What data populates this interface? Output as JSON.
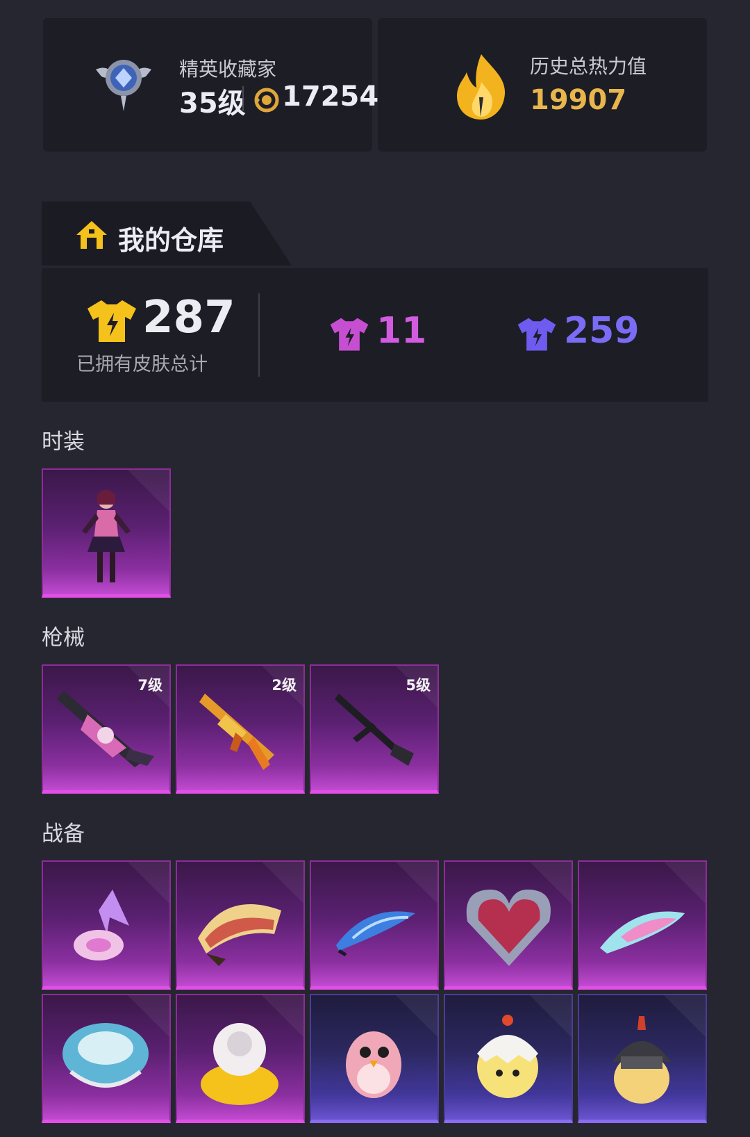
{
  "profile": {
    "collector_title": "精英收藏家",
    "level": "35级",
    "score": "17254",
    "heat_label": "历史总热力值",
    "heat_value": "19907"
  },
  "warehouse": {
    "tab_title": "我的仓库",
    "total_skins": "287",
    "total_label": "已拥有皮肤总计",
    "purple_count": "11",
    "blue_count": "259",
    "colors": {
      "gold": "#f4c21a",
      "purple": "#c64fd1",
      "blue": "#6e5cf0"
    }
  },
  "sections": [
    {
      "label": "时装",
      "items": [
        {
          "icon": "character-outfit"
        }
      ]
    },
    {
      "label": "枪械",
      "items": [
        {
          "icon": "rifle-anime",
          "level": "7级"
        },
        {
          "icon": "rifle-gold",
          "level": "2级"
        },
        {
          "icon": "machine-gun",
          "level": "5级"
        }
      ]
    },
    {
      "label": "战备",
      "items": [
        {
          "icon": "crystal-candy-parachute"
        },
        {
          "icon": "painted-parachute"
        },
        {
          "icon": "blue-parachute"
        },
        {
          "icon": "heart-parachute"
        },
        {
          "icon": "pink-cyan-parachute"
        },
        {
          "icon": "round-parachute"
        },
        {
          "icon": "sheep-parachute"
        },
        {
          "icon": "pink-bird-figure"
        },
        {
          "icon": "egg-chick-figure"
        },
        {
          "icon": "helmet-chick-figure"
        }
      ]
    }
  ]
}
